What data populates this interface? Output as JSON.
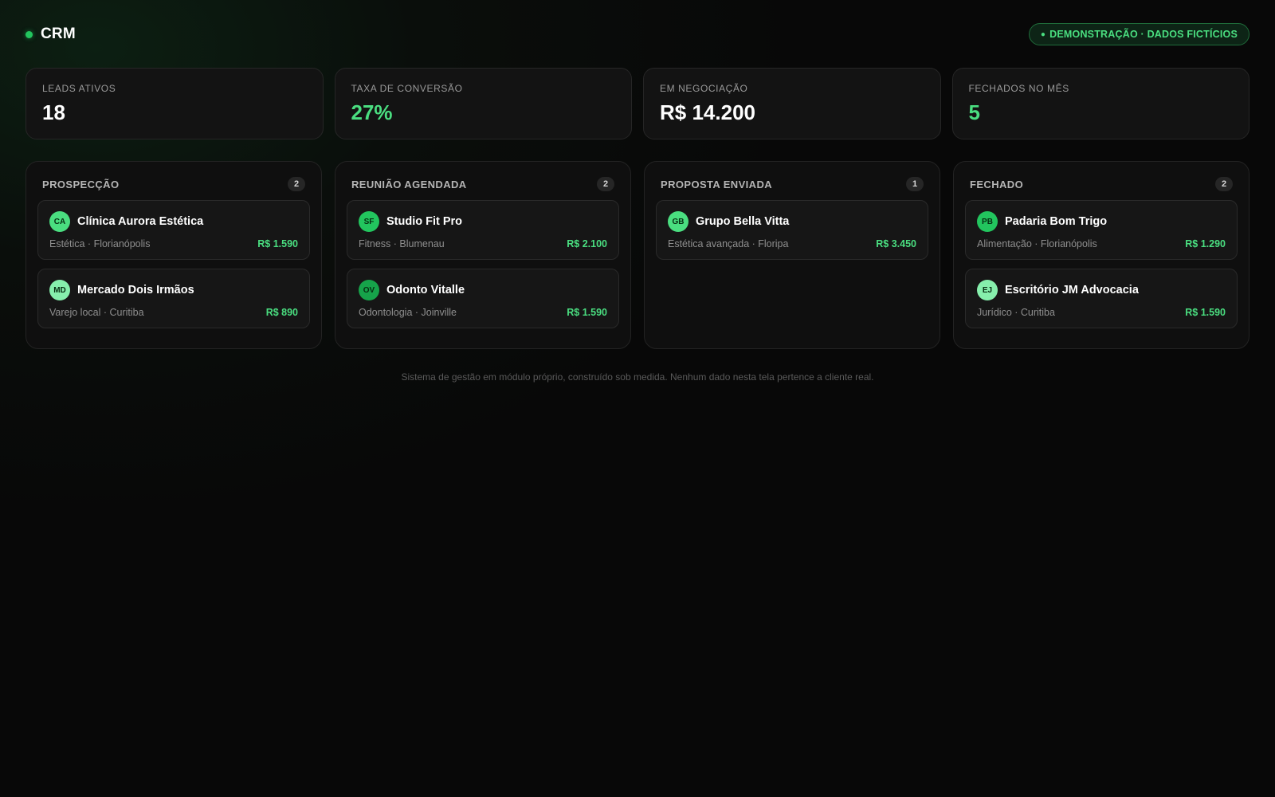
{
  "header": {
    "title": "CRM",
    "demo_badge": "DEMONSTRAÇÃO · DADOS FICTÍCIOS",
    "demo_dot": "●"
  },
  "colors": {
    "accent": "#22c55e",
    "accent_text": "#4ade80"
  },
  "kpis": [
    {
      "label": "LEADS ATIVOS",
      "value": "18",
      "accent": false
    },
    {
      "label": "TAXA DE CONVERSÃO",
      "value": "27%",
      "accent": true
    },
    {
      "label": "EM NEGOCIAÇÃO",
      "value": "R$ 14.200",
      "accent": false
    },
    {
      "label": "FECHADOS NO MÊS",
      "value": "5",
      "accent": true
    }
  ],
  "columns": [
    {
      "title": "PROSPECÇÃO",
      "count": "2",
      "cards": [
        {
          "initials": "CA",
          "avatar_color": "#4ade80",
          "name": "Clínica Aurora Estética",
          "meta": "Estética · Florianópolis",
          "value": "R$ 1.590"
        },
        {
          "initials": "MD",
          "avatar_color": "#86efac",
          "name": "Mercado Dois Irmãos",
          "meta": "Varejo local · Curitiba",
          "value": "R$ 890"
        }
      ]
    },
    {
      "title": "REUNIÃO AGENDADA",
      "count": "2",
      "cards": [
        {
          "initials": "SF",
          "avatar_color": "#22c55e",
          "name": "Studio Fit Pro",
          "meta": "Fitness · Blumenau",
          "value": "R$ 2.100"
        },
        {
          "initials": "OV",
          "avatar_color": "#16a34a",
          "name": "Odonto Vitalle",
          "meta": "Odontologia · Joinville",
          "value": "R$ 1.590"
        }
      ]
    },
    {
      "title": "PROPOSTA ENVIADA",
      "count": "1",
      "cards": [
        {
          "initials": "GB",
          "avatar_color": "#4ade80",
          "name": "Grupo Bella Vitta",
          "meta": "Estética avançada · Floripa",
          "value": "R$ 3.450"
        }
      ]
    },
    {
      "title": "FECHADO",
      "count": "2",
      "cards": [
        {
          "initials": "PB",
          "avatar_color": "#22c55e",
          "name": "Padaria Bom Trigo",
          "meta": "Alimentação · Florianópolis",
          "value": "R$ 1.290"
        },
        {
          "initials": "EJ",
          "avatar_color": "#86efac",
          "name": "Escritório JM Advocacia",
          "meta": "Jurídico · Curitiba",
          "value": "R$ 1.590"
        }
      ]
    }
  ],
  "footer": {
    "note": "Sistema de gestão em módulo próprio, construído sob medida. Nenhum dado nesta tela pertence a cliente real."
  }
}
